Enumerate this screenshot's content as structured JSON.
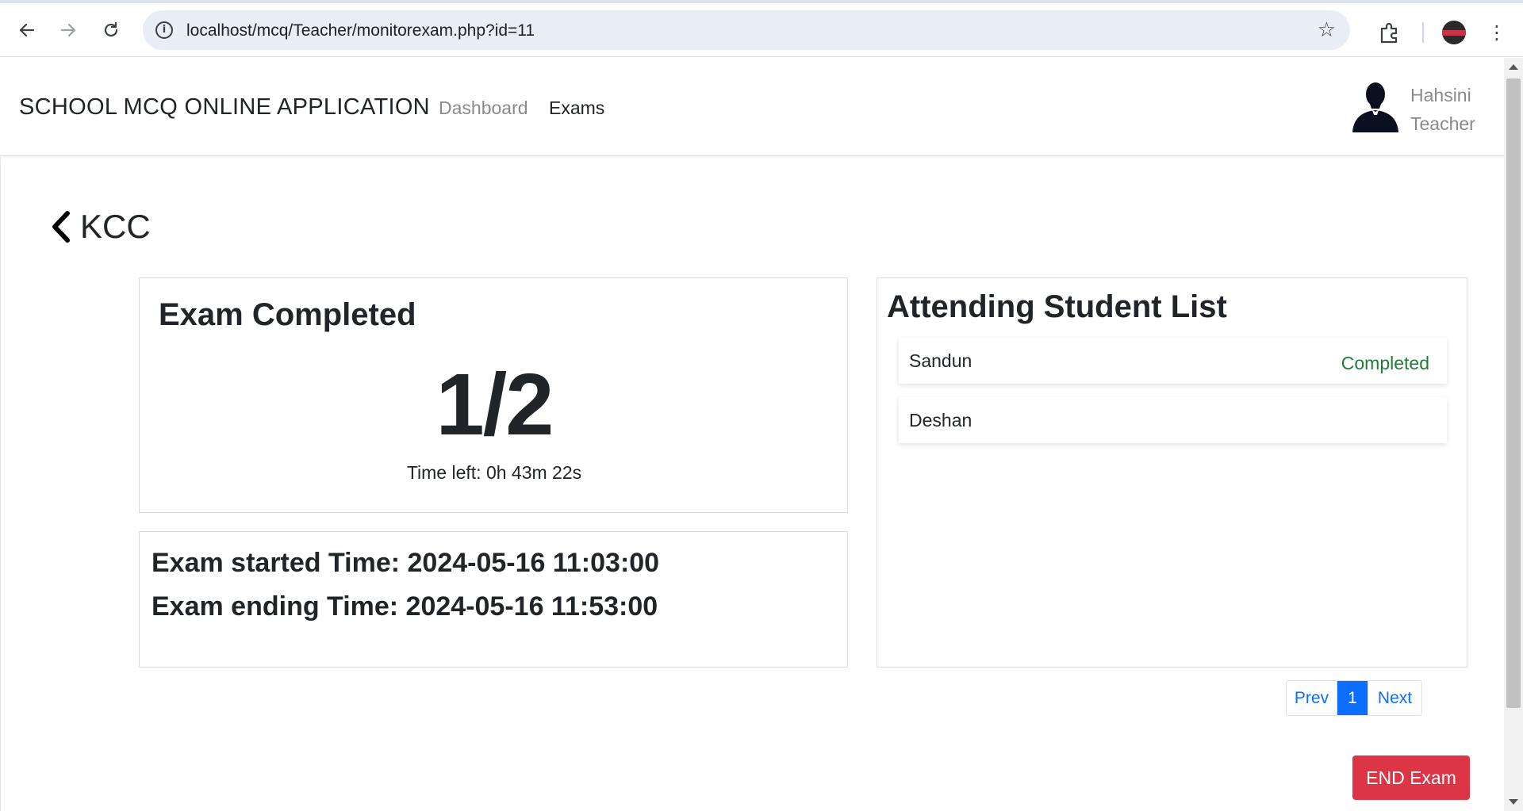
{
  "browser": {
    "url": "localhost/mcq/Teacher/monitorexam.php?id=11",
    "icons": [
      "back-arrow-icon",
      "forward-arrow-icon",
      "reload-icon",
      "site-info-icon",
      "bookmark-star-icon",
      "extensions-icon",
      "profile-avatar",
      "more-menu-icon"
    ]
  },
  "navbar": {
    "brand": "SCHOOL MCQ ONLINE APPLICATION",
    "links": [
      "Dashboard",
      "Exams"
    ],
    "user": {
      "name": "Hahsini",
      "role": "Teacher"
    }
  },
  "page": {
    "back_title": "KCC",
    "completed_card": {
      "title": "Exam Completed",
      "count": "1/2",
      "time_left": "Time left: 0h 43m 22s"
    },
    "times_card": {
      "started": "Exam started Time: 2024-05-16 11:03:00",
      "ending": "Exam ending Time: 2024-05-16 11:53:00"
    },
    "students_card": {
      "title": "Attending Student List",
      "students": [
        {
          "name": "Sandun",
          "status": "Completed"
        },
        {
          "name": "Deshan",
          "status": ""
        }
      ]
    },
    "pagination": {
      "prev": "Prev",
      "current": "1",
      "next": "Next"
    },
    "end_button": "END Exam"
  },
  "colors": {
    "primary": "#0d6efd",
    "danger": "#dc3545",
    "success": "#1e7e34",
    "muted": "#8a8a8a"
  }
}
